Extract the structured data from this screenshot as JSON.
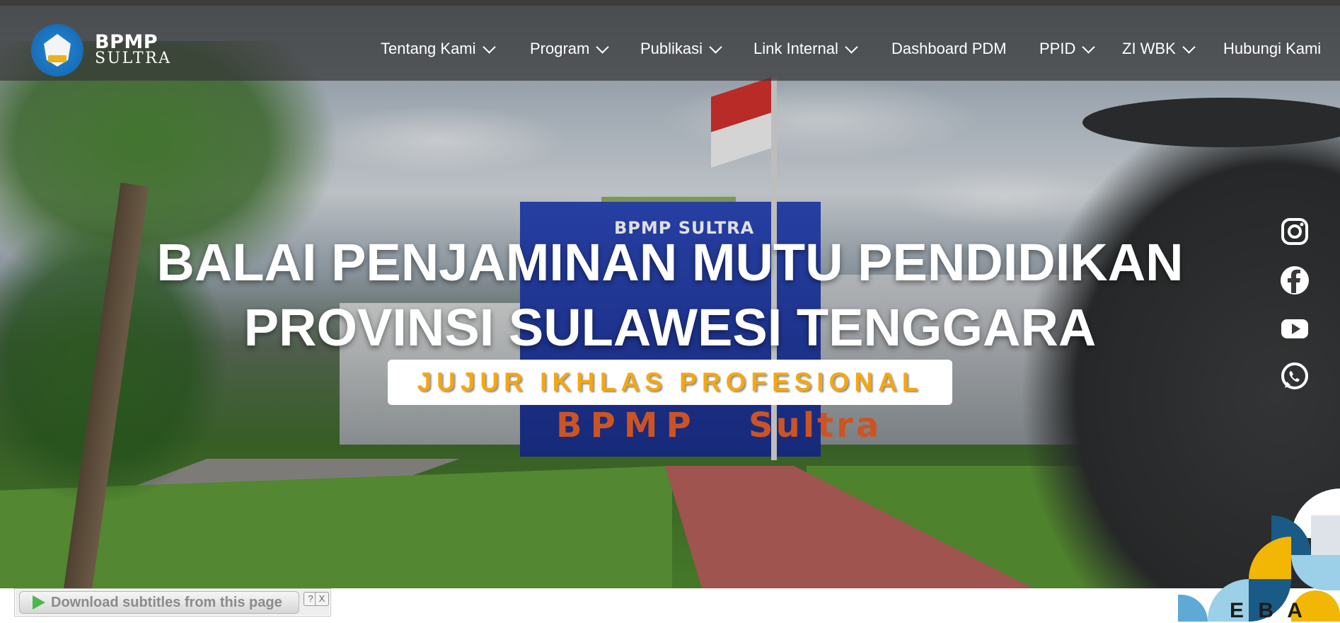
{
  "brand": {
    "title": "BPMP",
    "subtitle": "SULTRA"
  },
  "nav": {
    "items": [
      {
        "label": "Tentang Kami",
        "dropdown": true
      },
      {
        "label": "Program",
        "dropdown": true
      },
      {
        "label": "Publikasi",
        "dropdown": true
      },
      {
        "label": "Link Internal",
        "dropdown": true
      },
      {
        "label": "Dashboard PDM",
        "dropdown": false
      },
      {
        "label": "PPID",
        "dropdown": true
      },
      {
        "label": "ZI WBK",
        "dropdown": true
      },
      {
        "label": "Hubungi Kami",
        "dropdown": false
      }
    ]
  },
  "hero": {
    "title_line1": "BALAI PENJAMINAN MUTU PENDIDIKAN",
    "title_line2": "PROVINSI SULAWESI TENGGARA",
    "motto": "JUJUR IKHLAS PROFESIONAL",
    "photo_sign": "BPMP SULTRA",
    "photo_letters_left": "BPMP",
    "photo_letters_right": "Sultra"
  },
  "social": [
    "instagram-icon",
    "facebook-icon",
    "youtube-icon",
    "whatsapp-icon"
  ],
  "subtitle_widget": {
    "label": "Download subtitles from this page",
    "help": "?",
    "close": "X"
  },
  "bottom_partial_text": "E    B A",
  "colors": {
    "navbar": "#373737",
    "motto_text": "#f3a712",
    "motto_bg": "#ffffff",
    "hero_text": "#ffffff"
  }
}
